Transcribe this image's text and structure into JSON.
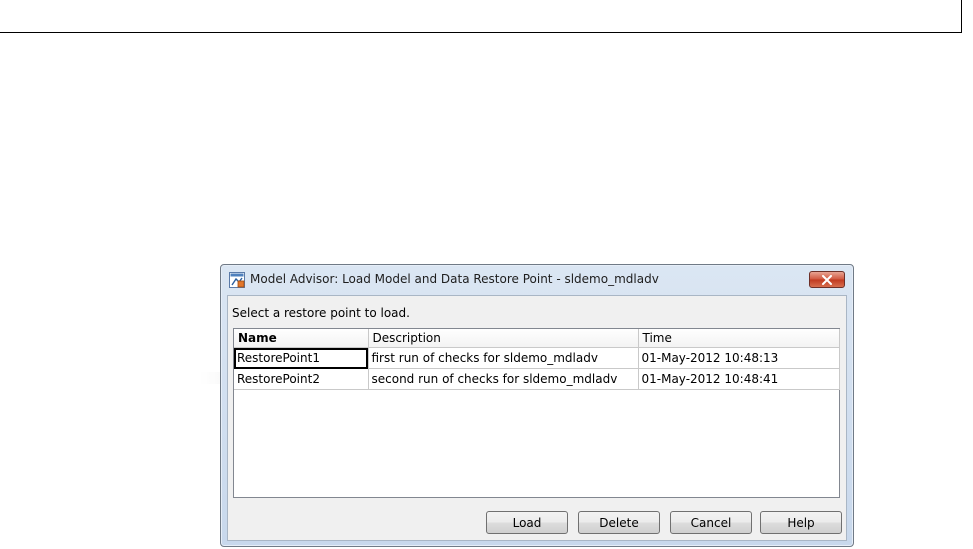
{
  "dialog": {
    "title": "Model Advisor: Load Model and Data Restore Point - sldemo_mdladv",
    "app_icon": "model-advisor-icon",
    "close_icon": "close-icon",
    "prompt": "Select a restore point to load."
  },
  "table": {
    "columns": [
      "Name",
      "Description",
      "Time"
    ],
    "rows": [
      {
        "name": "RestorePoint1",
        "description": "first run of checks for sldemo_mdladv",
        "time": "01-May-2012 10:48:13"
      },
      {
        "name": "RestorePoint2",
        "description": "second run of checks for sldemo_mdladv",
        "time": "01-May-2012 10:48:41"
      }
    ]
  },
  "buttons": {
    "load": "Load",
    "delete": "Delete",
    "cancel": "Cancel",
    "help": "Help"
  },
  "colors": {
    "close_button": "#c0391f",
    "titlebar": "#dbe6f3"
  }
}
